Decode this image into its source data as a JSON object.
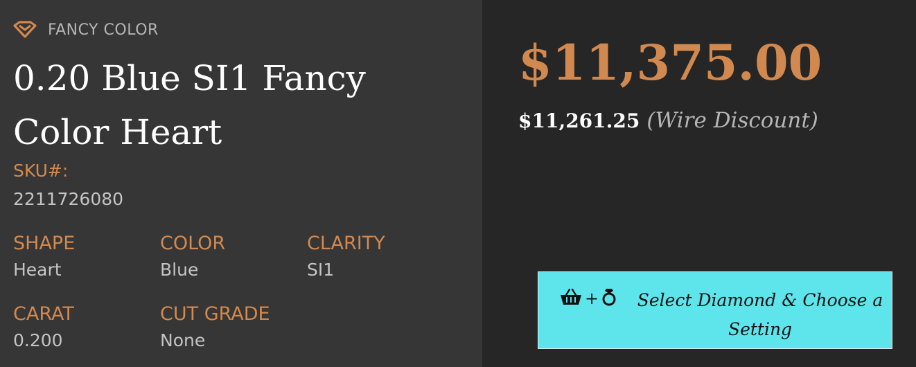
{
  "product": {
    "category": "FANCY COLOR",
    "title": "0.20 Blue SI1 Fancy Color Heart",
    "sku_label": "SKU#:",
    "sku_value": "2211726080",
    "specs": [
      {
        "label": "SHAPE",
        "value": "Heart"
      },
      {
        "label": "COLOR",
        "value": "Blue"
      },
      {
        "label": "CLARITY",
        "value": "SI1"
      },
      {
        "label": "CARAT",
        "value": "0.200"
      },
      {
        "label": "CUT GRADE",
        "value": "None"
      }
    ]
  },
  "pricing": {
    "price": "$11,375.00",
    "wire_price": "$11,261.25",
    "wire_note": "(Wire Discount)"
  },
  "action": {
    "select_label": "Select Diamond & Choose a Setting",
    "icons": [
      "basket-icon",
      "ring-icon"
    ]
  },
  "colors": {
    "accent": "#d2894f",
    "button": "#5ee5ec",
    "left_panel": "#363636",
    "right_panel": "#262626"
  }
}
